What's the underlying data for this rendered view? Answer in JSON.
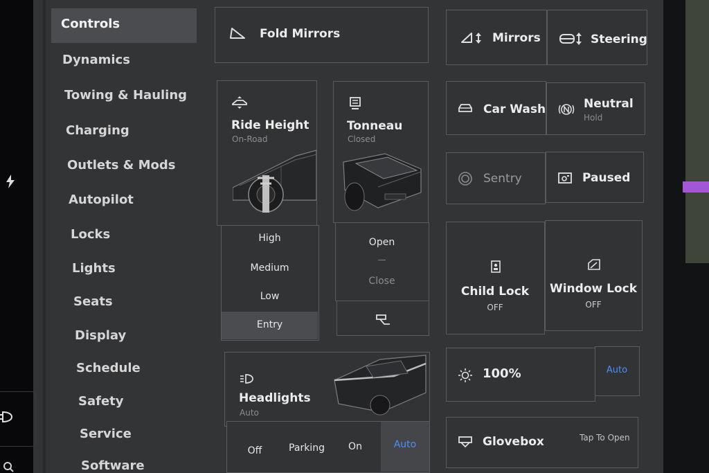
{
  "sidebar": {
    "items": [
      {
        "label": "Controls"
      },
      {
        "label": "Dynamics"
      },
      {
        "label": "Towing & Hauling"
      },
      {
        "label": "Charging"
      },
      {
        "label": "Outlets & Mods"
      },
      {
        "label": "Autopilot"
      },
      {
        "label": "Locks"
      },
      {
        "label": "Lights"
      },
      {
        "label": "Seats"
      },
      {
        "label": "Display"
      },
      {
        "label": "Schedule"
      },
      {
        "label": "Safety"
      },
      {
        "label": "Service"
      },
      {
        "label": "Software"
      }
    ]
  },
  "fold_mirrors": {
    "label": "Fold Mirrors"
  },
  "mirrors": {
    "label": "Mirrors"
  },
  "steering": {
    "label": "Steering"
  },
  "ride_height": {
    "title": "Ride Height",
    "status": "On-Road",
    "options": [
      "High",
      "Medium",
      "Low",
      "Entry"
    ],
    "selected": "Entry"
  },
  "tonneau": {
    "title": "Tonneau",
    "status": "Closed",
    "open": "Open",
    "divider": "—",
    "close": "Close"
  },
  "car_wash": {
    "label": "Car Wash"
  },
  "neutral": {
    "label": "Neutral",
    "sub": "Hold"
  },
  "sentry": {
    "label": "Sentry"
  },
  "dashcam": {
    "label": "Paused"
  },
  "child_lock": {
    "label": "Child Lock",
    "status": "OFF"
  },
  "window_lock": {
    "label": "Window Lock",
    "status": "OFF"
  },
  "headlights": {
    "title": "Headlights",
    "status": "Auto",
    "options": [
      "Off",
      "Parking",
      "On",
      "Auto"
    ],
    "selected": "Auto"
  },
  "brightness": {
    "value": "100%",
    "auto": "Auto"
  },
  "glovebox": {
    "label": "Glovebox",
    "hint": "Tap To Open"
  },
  "colors": {
    "accent": "#4f8df5",
    "panel": "#333436",
    "selected": "#4a4b4e"
  }
}
